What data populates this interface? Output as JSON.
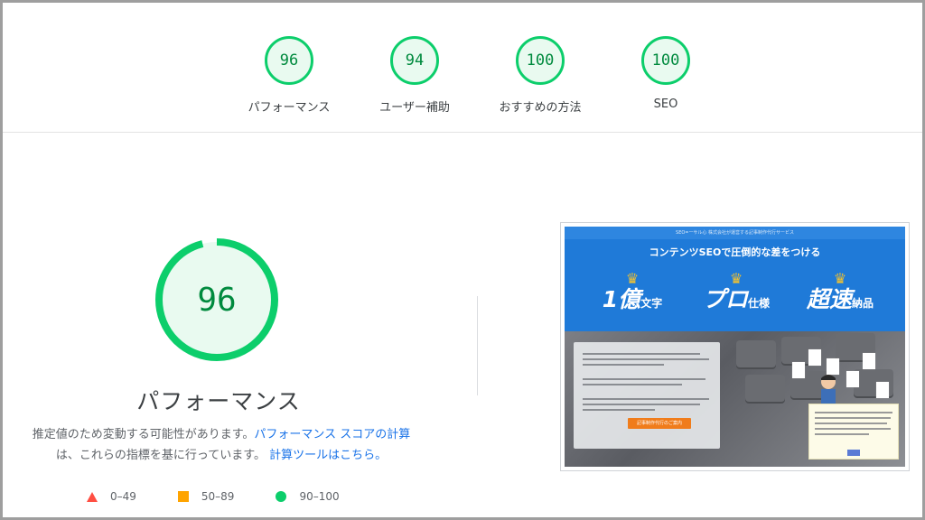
{
  "summary": [
    {
      "score": "96",
      "label": "パフォーマンス"
    },
    {
      "score": "94",
      "label": "ユーザー補助"
    },
    {
      "score": "100",
      "label": "おすすめの方法"
    },
    {
      "score": "100",
      "label": "SEO"
    }
  ],
  "main": {
    "score": "96",
    "score_fraction": 0.96,
    "title": "パフォーマンス",
    "desc_pre": "推定値のため変動する可能性があります。",
    "desc_link1": "パフォーマンス スコアの計算",
    "desc_mid": "は、これらの指標を基に行っています。",
    "desc_link2": "計算ツールはこちら。"
  },
  "legend": [
    {
      "range": "0–49",
      "shape": "triangle",
      "color": "#ff4e42"
    },
    {
      "range": "50–89",
      "shape": "square",
      "color": "#ffa400"
    },
    {
      "range": "90–100",
      "shape": "circle",
      "color": "#0cce6b"
    }
  ],
  "colors": {
    "pass": "#0cce6b",
    "pass_text": "#008a3e",
    "link": "#1a73e8"
  },
  "thumbnail": {
    "top_strip": "SEO=ーサル心 株式会社が運営する記事制作代行サービス",
    "headline": "コンテンツSEOで圧倒的な差をつける",
    "feature1": "1億",
    "feature1_side": "文字",
    "feature2": "プロ",
    "feature2_side": "仕様",
    "feature3": "超速",
    "feature3_side": "納品",
    "cta": "記事制作代行のご案内"
  }
}
